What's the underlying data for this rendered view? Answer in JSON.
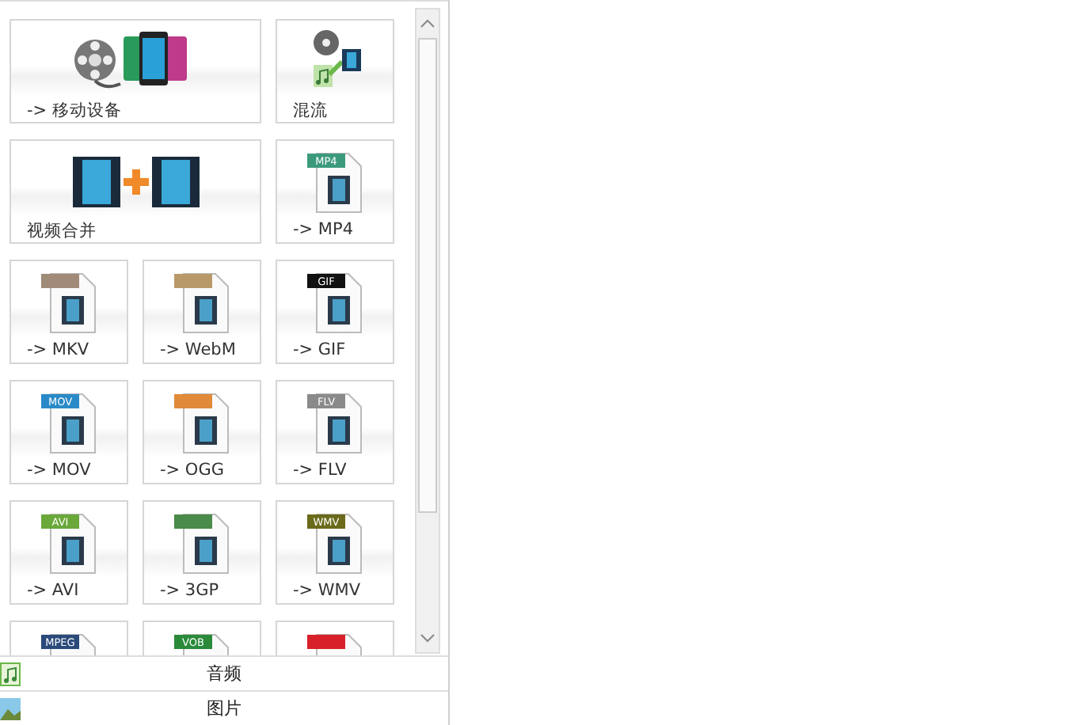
{
  "tiles": [
    {
      "kind": "device",
      "label": "-> 移动设备",
      "wide": true
    },
    {
      "kind": "mux",
      "label": "混流",
      "wide": false
    },
    {
      "kind": "join",
      "label": "视频合并",
      "wide": true
    },
    {
      "kind": "file",
      "label": "-> MP4",
      "badge": "MP4",
      "color": "#3c9a7c",
      "wide": false
    },
    {
      "kind": "file",
      "label": "-> MKV",
      "color": "#a08a78",
      "wide": false
    },
    {
      "kind": "file",
      "label": "-> WebM",
      "color": "#b89a6a",
      "wide": false
    },
    {
      "kind": "file",
      "label": "-> GIF",
      "badge": "GIF",
      "color": "#111111",
      "wide": false
    },
    {
      "kind": "file",
      "label": "-> MOV",
      "badge": "MOV",
      "color": "#2a8ac8",
      "wide": false
    },
    {
      "kind": "file",
      "label": "-> OGG",
      "color": "#e08a3a",
      "wide": false
    },
    {
      "kind": "file",
      "label": "-> FLV",
      "badge": "FLV",
      "color": "#8a8a8a",
      "wide": false
    },
    {
      "kind": "file",
      "label": "-> AVI",
      "badge": "AVI",
      "color": "#6aa83a",
      "wide": false
    },
    {
      "kind": "file",
      "label": "-> 3GP",
      "color": "#4a8a4a",
      "wide": false
    },
    {
      "kind": "file",
      "label": "-> WMV",
      "badge": "WMV",
      "color": "#6a6a1a",
      "wide": false
    },
    {
      "kind": "file",
      "badge": "MPEG",
      "color": "#2a4a7a",
      "wide": false
    },
    {
      "kind": "file",
      "badge": "VOB",
      "color": "#2a8a3a",
      "wide": false
    },
    {
      "kind": "file",
      "color": "#d8202a",
      "wide": false
    }
  ],
  "categories": [
    {
      "kind": "audio",
      "label": "音频"
    },
    {
      "kind": "picture",
      "label": "图片"
    }
  ]
}
